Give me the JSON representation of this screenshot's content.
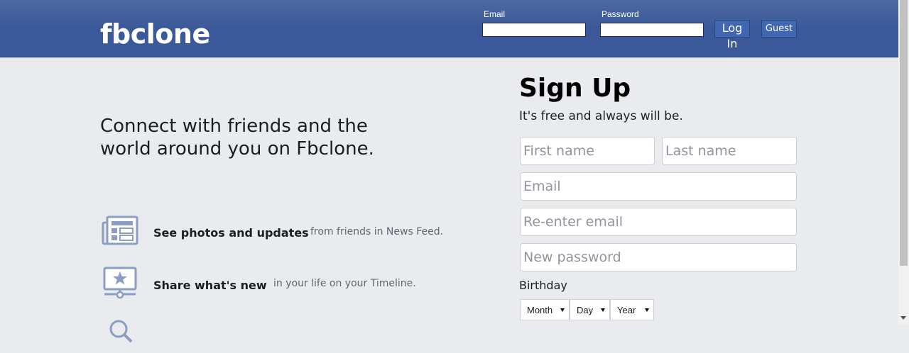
{
  "header": {
    "logo": "fbclone",
    "email_label": "Email",
    "password_label": "Password",
    "login_label": "Log In",
    "guest_label": "Guest"
  },
  "left": {
    "tagline": "Connect with friends and the world around you on Fbclone.",
    "features": [
      {
        "icon": "news-feed-icon",
        "bold": "See photos and updates",
        "light": "from friends in News Feed."
      },
      {
        "icon": "timeline-star-icon",
        "bold": "Share what's new",
        "light": "in your life on your Timeline."
      },
      {
        "icon": "search-icon",
        "bold": "",
        "light": ""
      }
    ]
  },
  "signup": {
    "title": "Sign Up",
    "subtitle": "It's free and always will be.",
    "first_name_placeholder": "First name",
    "last_name_placeholder": "Last name",
    "email_placeholder": "Email",
    "reenter_email_placeholder": "Re-enter email",
    "password_placeholder": "New password",
    "birthday_label": "Birthday",
    "month_value": "Month",
    "day_value": "Day",
    "year_value": "Year"
  },
  "colors": {
    "header_bg": "#3b5998",
    "page_bg": "#e9ebee",
    "icon_color": "#8b9dc3"
  }
}
